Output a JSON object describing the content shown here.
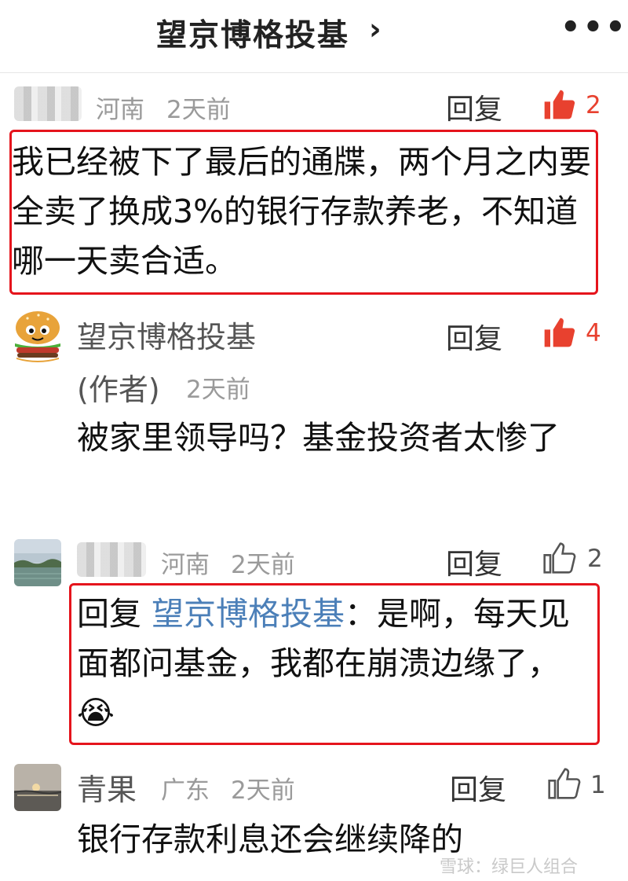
{
  "header": {
    "title": "望京博格投基",
    "chevron": "›",
    "more": "•••"
  },
  "comments": [
    {
      "location": "河南",
      "time": "2天前",
      "reply": "回复",
      "likes": "2",
      "body": "我已经被下了最后的通牒，两个月之内要全卖了换成3%的银行存款养老，不知道哪一天卖合适。"
    },
    {
      "name": "望京博格投基",
      "author_tag": "(作者)",
      "time": "2天前",
      "reply": "回复",
      "likes": "4",
      "body": "被家里领导吗？基金投资者太惨了"
    },
    {
      "location": "河南",
      "time": "2天前",
      "reply": "回复",
      "likes": "2",
      "reply_prefix": "回复",
      "mention": "望京博格投基",
      "body": "：是啊，每天见面都问基金，我都在崩溃边缘了，",
      "emoji": "😭"
    },
    {
      "name": "青果",
      "location": "广东",
      "time": "2天前",
      "reply": "回复",
      "likes": "1",
      "body": "银行存款利息还会继续降的"
    }
  ],
  "watermark": "雪球：绿巨人组合",
  "colors": {
    "highlight_border": "#e5141c",
    "like_active": "#e8412f",
    "mention": "#4b7fb8"
  }
}
